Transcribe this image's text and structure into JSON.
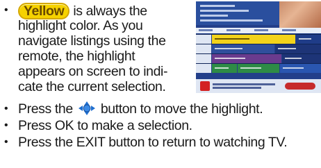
{
  "bullets": [
    {
      "pill": "Yellow",
      "lines": [
        " is always the",
        "highlight color. As you",
        "navigate listings using the",
        "remote, the highlight",
        "appears on screen to indi-",
        "cate the current selection."
      ]
    },
    {
      "pre": "Press the ",
      "icon": "directional-pad-icon",
      "post": " button to move the highlight."
    },
    {
      "text": "Press OK to make a selection."
    },
    {
      "text": "Press the EXIT button to return to watching TV."
    }
  ],
  "bullet_char": "•",
  "colors": {
    "highlight_yellow": "#f6d200",
    "guide_blue": "#233f8a",
    "dpad_blue": "#1f6fd0"
  }
}
